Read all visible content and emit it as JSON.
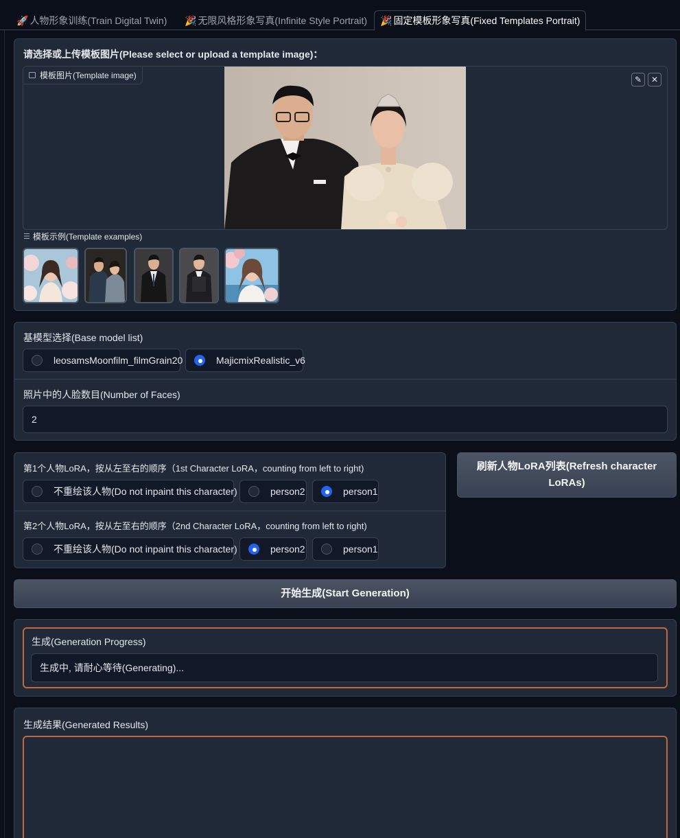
{
  "tabs": [
    {
      "emoji": "🚀",
      "label": "人物形象训练(Train Digital Twin)"
    },
    {
      "emoji": "🎉",
      "label": "无限风格形象写真(Infinite Style Portrait)"
    },
    {
      "emoji": "🎉",
      "label": "固定模板形象写真(Fixed Templates Portrait)"
    }
  ],
  "template": {
    "heading": "请选择或上传模板图片(Please select or upload a template image)：",
    "image_label": "模板图片(Template image)",
    "examples_label": "模板示例(Template examples)"
  },
  "base_model": {
    "label": "基模型选择(Base model list)",
    "options": [
      "leosamsMoonfilm_filmGrain20",
      "MajicmixRealistic_v6"
    ],
    "selected": "MajicmixRealistic_v6"
  },
  "faces": {
    "label": "照片中的人脸数目(Number of Faces)",
    "value": "2"
  },
  "lora1": {
    "label": "第1个人物LoRA，按从左至右的顺序（1st Character LoRA，counting from left to right)",
    "options": [
      "不重绘该人物(Do not inpaint this character)",
      "person2",
      "person1"
    ],
    "selected": "person1"
  },
  "lora2": {
    "label": "第2个人物LoRA，按从左至右的顺序（2nd Character LoRA，counting from left to right)",
    "options": [
      "不重绘该人物(Do not inpaint this character)",
      "person2",
      "person1"
    ],
    "selected": "person2"
  },
  "refresh_button": "刷新人物LoRA列表(Refresh character LoRAs)",
  "start_button": "开始生成(Start Generation)",
  "progress": {
    "label": "生成(Generation Progress)",
    "value": "生成中, 请耐心等待(Generating)..."
  },
  "results": {
    "label": "生成结果(Generated Results)"
  },
  "colors": {
    "background": "#0b0f19",
    "panel": "#1f2937",
    "accent_radio": "#2563eb",
    "progress_border": "#c2683f"
  }
}
